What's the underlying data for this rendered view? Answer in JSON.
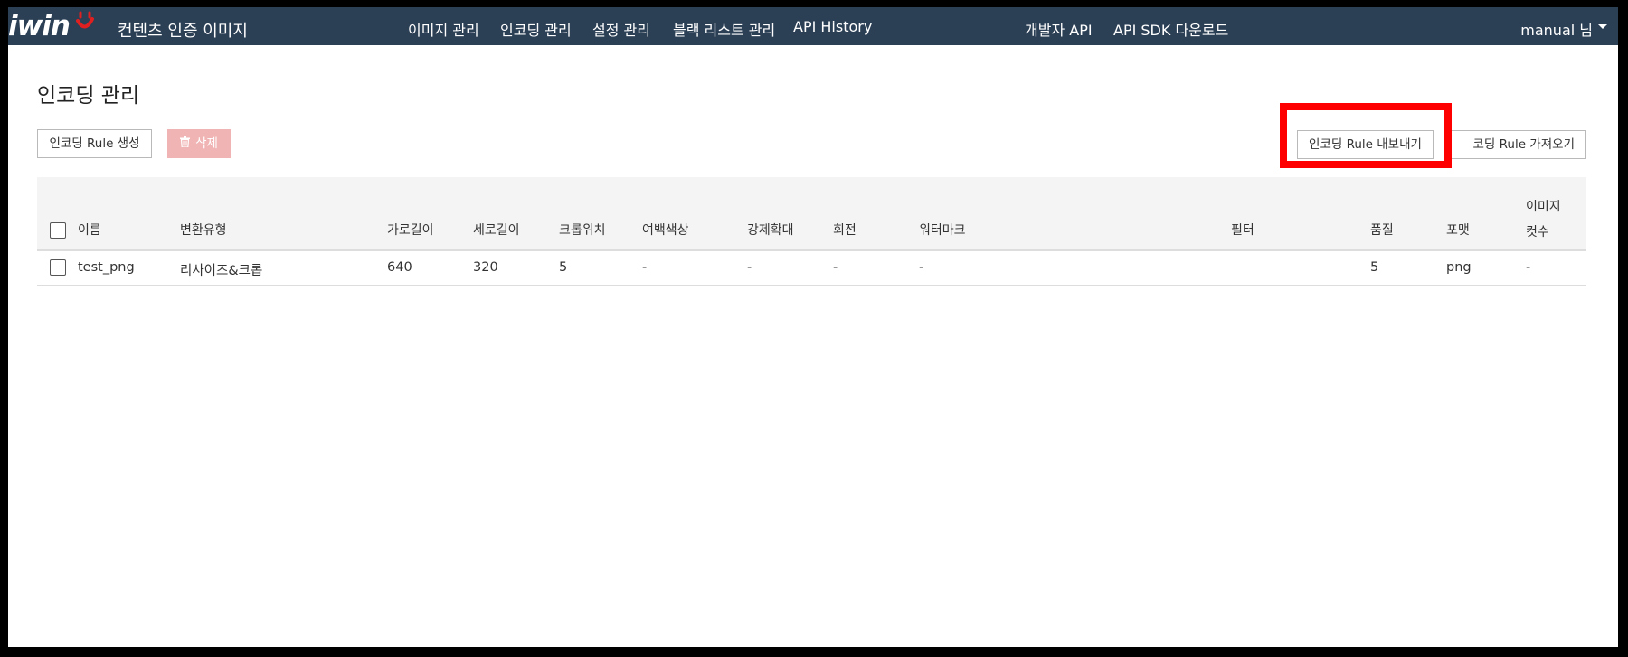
{
  "header": {
    "logo_text": "iwin",
    "app_title": "컨텐츠 인증 이미지",
    "nav": [
      "이미지 관리",
      "인코딩 관리",
      "설정 관리",
      "블랙 리스트 관리",
      "API History"
    ],
    "nav_right": [
      "개발자 API",
      "API SDK 다운로드"
    ],
    "user": "manual 님",
    "brand_color": "#2b3f55",
    "logo_accent": "#e02020"
  },
  "page": {
    "title": "인코딩 관리"
  },
  "toolbar": {
    "create_label": "인코딩 Rule 생성",
    "delete_label": "삭제",
    "export_label": "인코딩 Rule 내보내기",
    "import_label": "코딩 Rule 가져오기"
  },
  "table": {
    "columns": [
      "이름",
      "변환유형",
      "가로길이",
      "세로길이",
      "크롭위치",
      "여백색상",
      "강제확대",
      "회전",
      "워터마크",
      "필터",
      "품질",
      "포맷"
    ],
    "last_column": [
      "이미지",
      "컷수"
    ],
    "rows": [
      [
        "test_png",
        "리사이즈&크롭",
        "640",
        "320",
        "5",
        "-",
        "-",
        "-",
        "-",
        "",
        "5",
        "png",
        "-"
      ]
    ]
  },
  "annotation": {
    "highlight_color": "#ff0000"
  }
}
